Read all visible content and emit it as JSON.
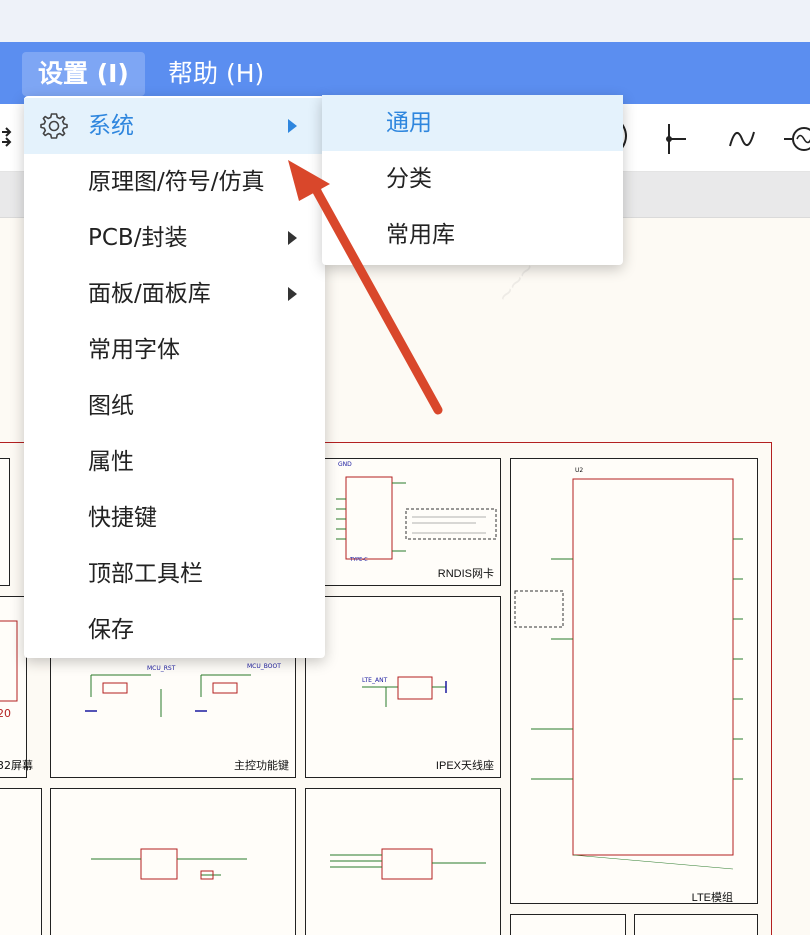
{
  "menubar": {
    "items": [
      {
        "label": "设置 (I)"
      },
      {
        "label": "帮助 (H)"
      }
    ]
  },
  "dropdown": {
    "items": [
      {
        "label": "系统",
        "submenu": true
      },
      {
        "label": "原理图/符号/仿真"
      },
      {
        "label": "PCB/封装",
        "submenu": true
      },
      {
        "label": "面板/面板库",
        "submenu": true
      },
      {
        "label": "常用字体"
      },
      {
        "label": "图纸"
      },
      {
        "label": "属性"
      },
      {
        "label": "快捷键"
      },
      {
        "label": "顶部工具栏"
      },
      {
        "label": "保存"
      }
    ]
  },
  "submenu": {
    "items": [
      {
        "label": "通用"
      },
      {
        "label": "分类"
      },
      {
        "label": "常用库"
      }
    ]
  },
  "schematic": {
    "panels": [
      {
        "label": "RNDIS网卡"
      },
      {
        "label": "LTE模组"
      },
      {
        "label": "主控功能键"
      },
      {
        "label": "IPEX天线座"
      },
      {
        "label": "32屏幕"
      }
    ],
    "snippets": {
      "gnd": "GND",
      "usb_title": "TYPE-C",
      "mcu_rst": "MCU_RST",
      "mcu_boot": "MCU_BOOT",
      "lte_ant": "LTE_ANT",
      "u2": "U2",
      "partial_num": "20"
    }
  },
  "colors": {
    "menubar": "#5b8ef0",
    "highlight_bg": "#e4f2fc",
    "highlight_text": "#2e86de",
    "arrow": "#d9472b",
    "sheet_border": "#b32020"
  },
  "icons": [
    "gear-icon",
    "submenu-arrow-icon",
    "wire-icon",
    "junction-icon",
    "sine-icon",
    "ac-source-icon"
  ]
}
